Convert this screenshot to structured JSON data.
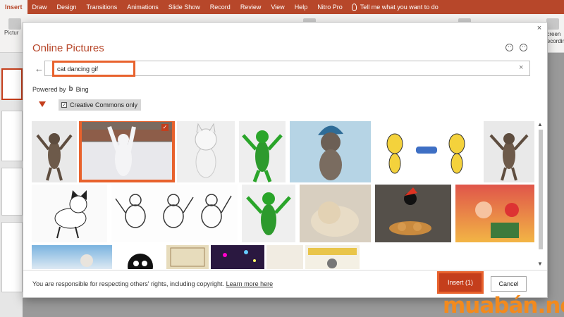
{
  "app": {
    "ribbon_tabs": [
      {
        "label": "Insert",
        "active": true
      },
      {
        "label": "Draw"
      },
      {
        "label": "Design"
      },
      {
        "label": "Transitions"
      },
      {
        "label": "Animations"
      },
      {
        "label": "Slide Show"
      },
      {
        "label": "Record"
      },
      {
        "label": "Review"
      },
      {
        "label": "View"
      },
      {
        "label": "Help"
      },
      {
        "label": "Nitro Pro"
      }
    ],
    "tell_me": "Tell me what you want to do",
    "pictures_label": "Pictur",
    "screen_recording_label": "Screen Recording"
  },
  "dialog": {
    "title": "Online Pictures",
    "close_glyph": "×",
    "search": {
      "value": "cat dancing gif",
      "clear_glyph": "×"
    },
    "powered_by": "Powered by",
    "bing": "Bing",
    "creative_commons": "Creative Commons only",
    "creative_commons_checked": true,
    "results_count_selected": 1,
    "footer": {
      "disclaimer": "You are responsible for respecting others' rights, including copyright.",
      "learn_more": "Learn more here"
    },
    "insert_label": "Insert (1)",
    "cancel_label": "Cancel"
  },
  "results": [
    {
      "name": "dancing-cat-brown",
      "selected": false
    },
    {
      "name": "dancing-cat-snow",
      "selected": true
    },
    {
      "name": "cat-white-dance",
      "selected": false
    },
    {
      "name": "cat-green-screen",
      "selected": false
    },
    {
      "name": "cat-blue-hat",
      "selected": false
    },
    {
      "name": "cat-yellow-cartoon",
      "selected": false
    },
    {
      "name": "dancing-cat-brown-2",
      "selected": false
    },
    {
      "name": "cat-cartoon-black-white",
      "selected": false
    },
    {
      "name": "cat-sketch-dancing",
      "selected": false
    },
    {
      "name": "cat-green-screen-2",
      "selected": false
    },
    {
      "name": "cat-kitten-cream",
      "selected": false
    },
    {
      "name": "cat-black-donuts",
      "selected": false
    },
    {
      "name": "cat-cartoon-party",
      "selected": false
    },
    {
      "name": "cat-sky-photo",
      "selected": false
    },
    {
      "name": "cat-black-cartoon-face",
      "selected": false
    },
    {
      "name": "cat-vintage-book",
      "selected": false
    },
    {
      "name": "cat-dance-stage",
      "selected": false
    },
    {
      "name": "cat-vintage-drawing",
      "selected": false
    },
    {
      "name": "cat-birthday-cartoon",
      "selected": false
    }
  ],
  "watermark": "muabán.net",
  "colors": {
    "accent": "#b7472a",
    "highlight": "#e8622d"
  }
}
